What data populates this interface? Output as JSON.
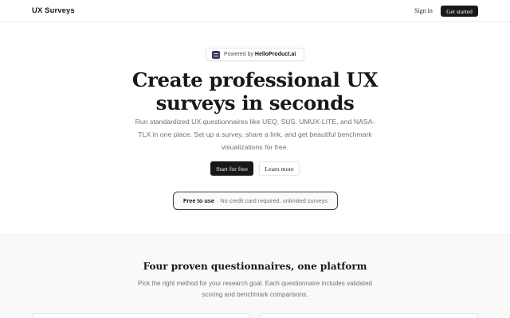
{
  "header": {
    "brand": "UX Surveys",
    "signin_label": "Sign in",
    "get_started_label": "Get started"
  },
  "hero": {
    "powered_by_prefix": "Powered by",
    "powered_by_brand": "HelloProduct.ai",
    "title_lines": [
      "Create professional UX",
      "surveys in seconds"
    ],
    "subtitle_lines": [
      "Run standardized UX questionnaires like UEQ, SUS, UMUX-LITE, and NASA-",
      "TLX in one place. Set up a survey, share a link, and get beautiful benchmark",
      "visualizations for free."
    ],
    "primary_cta": "Start for free",
    "secondary_cta": "Learn more",
    "badge_strong": "Free to use",
    "badge_rest": "· No credit card required, unlimited surveys"
  },
  "features": {
    "title": "Four proven questionnaires, one platform",
    "subtitle_lines": [
      "Pick the right method for your research goal. Each questionnaire includes validated",
      "scoring and benchmark comparisons."
    ]
  },
  "colors": {
    "primary": "#18181b",
    "muted_text": "#71717a",
    "border": "#e4e4e7",
    "section_bg": "#f9f9fa",
    "logo": "#3b3a63"
  }
}
